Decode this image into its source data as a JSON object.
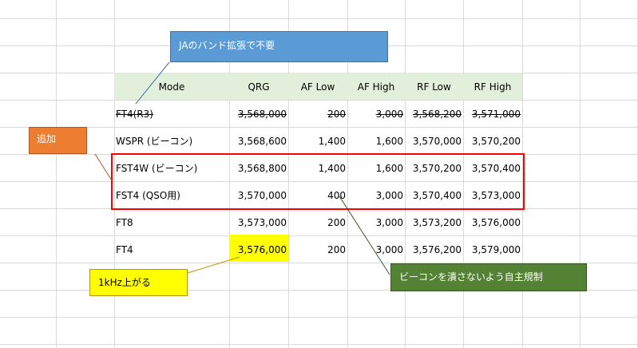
{
  "table": {
    "headers": [
      "Mode",
      "QRG",
      "AF Low",
      "AF High",
      "RF Low",
      "RF High"
    ],
    "rows": [
      {
        "mode": "FT4(R3)",
        "qrg": "3,568,000",
        "af_low": "200",
        "af_high": "3,000",
        "rf_low": "3,568,200",
        "rf_high": "3,571,000",
        "struck": true
      },
      {
        "mode": "WSPR (ビーコン)",
        "qrg": "3,568,600",
        "af_low": "1,400",
        "af_high": "1,600",
        "rf_low": "3,570,000",
        "rf_high": "3,570,200",
        "struck": false
      },
      {
        "mode": "FST4W (ビーコン)",
        "qrg": "3,568,800",
        "af_low": "1,400",
        "af_high": "1,600",
        "rf_low": "3,570,200",
        "rf_high": "3,570,400",
        "struck": false
      },
      {
        "mode": "FST4 (QSO用)",
        "qrg": "3,570,000",
        "af_low": "400",
        "af_high": "3,000",
        "rf_low": "3,570,400",
        "rf_high": "3,573,000",
        "struck": false
      },
      {
        "mode": "FT8",
        "qrg": "3,573,000",
        "af_low": "200",
        "af_high": "3,000",
        "rf_low": "3,573,200",
        "rf_high": "3,576,000",
        "struck": false
      },
      {
        "mode": "FT4",
        "qrg": "3,576,000",
        "af_low": "200",
        "af_high": "3,000",
        "rf_low": "3,576,200",
        "rf_high": "3,579,000",
        "struck": false
      }
    ]
  },
  "callouts": {
    "ja_band": "JAのバンド拡張で不要",
    "added": "追加",
    "up_1khz": "1kHz上がる",
    "beacon_note": "ビーコンを潰さないよう自主規制"
  },
  "colors": {
    "header_band": "#e2efda",
    "highlight": "#ffff00",
    "red_box": "#ff0000",
    "callout_blue": "#5b9bd5",
    "callout_orange": "#ed7d31",
    "callout_yellow": "#ffff00",
    "callout_green": "#548235"
  }
}
